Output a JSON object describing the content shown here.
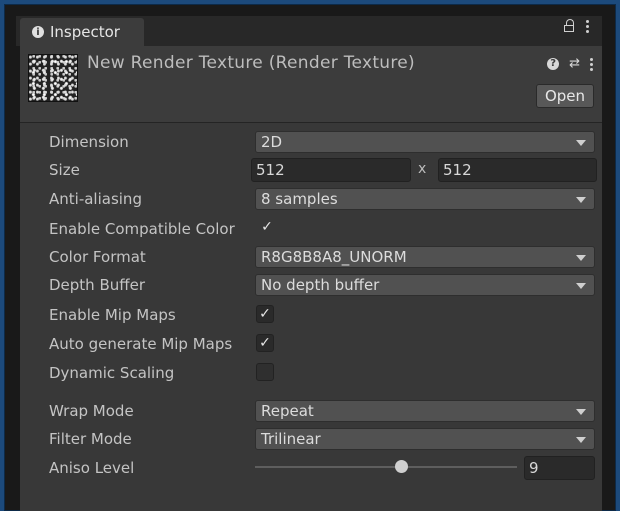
{
  "window": {
    "tab_title": "Inspector"
  },
  "asset": {
    "title": "New Render Texture (Render Texture)",
    "open_label": "Open"
  },
  "props": {
    "dimension": {
      "label": "Dimension",
      "value": "2D"
    },
    "size": {
      "label": "Size",
      "width": "512",
      "separator": "x",
      "height": "512"
    },
    "anti_aliasing": {
      "label": "Anti-aliasing",
      "value": "8 samples"
    },
    "compat_color": {
      "label": "Enable Compatible Color",
      "checked": true
    },
    "color_format": {
      "label": "Color Format",
      "value": "R8G8B8A8_UNORM"
    },
    "depth_buffer": {
      "label": "Depth Buffer",
      "value": "No depth buffer"
    },
    "mip_maps": {
      "label": "Enable Mip Maps",
      "checked": true
    },
    "auto_mip": {
      "label": "Auto generate Mip Maps",
      "checked": true
    },
    "dynamic_scaling": {
      "label": "Dynamic Scaling",
      "checked": false
    },
    "wrap_mode": {
      "label": "Wrap Mode",
      "value": "Repeat"
    },
    "filter_mode": {
      "label": "Filter Mode",
      "value": "Trilinear"
    },
    "aniso_level": {
      "label": "Aniso Level",
      "value": "9",
      "slider_fraction": 0.56
    }
  },
  "check_glyph": "✓",
  "colors": {
    "accent_border": "#1c4a7c",
    "panel_bg": "#383838"
  }
}
